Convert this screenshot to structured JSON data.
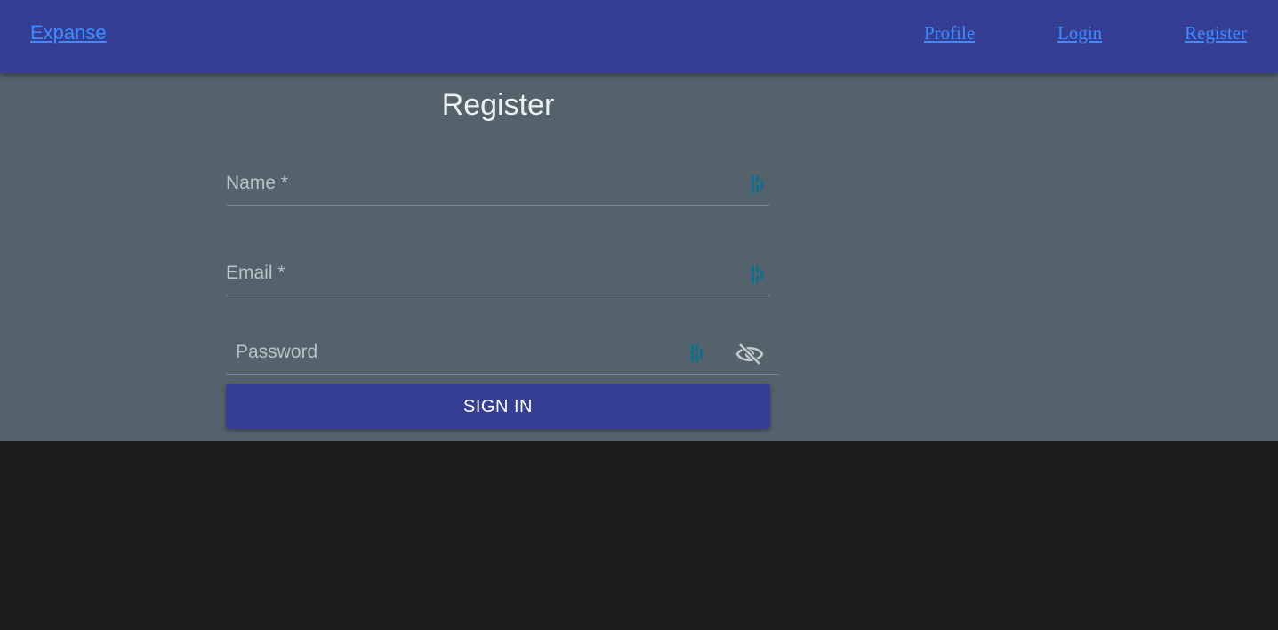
{
  "header": {
    "brand": "Expanse",
    "links": [
      "Profile",
      "Login",
      "Register"
    ]
  },
  "form": {
    "title": "Register",
    "name_label": "Name *",
    "email_label": "Email *",
    "password_placeholder": "Password",
    "submit_label": "SIGN IN"
  },
  "icons": {
    "password_manager": "password-manager-icon",
    "toggle_visibility": "eye-off-icon"
  },
  "colors": {
    "appbar": "#343f94",
    "link": "#3d8bff",
    "form_background": "#54626c",
    "page_background": "#1b1c1e",
    "password_manager_icon": "#0e6f8f"
  }
}
